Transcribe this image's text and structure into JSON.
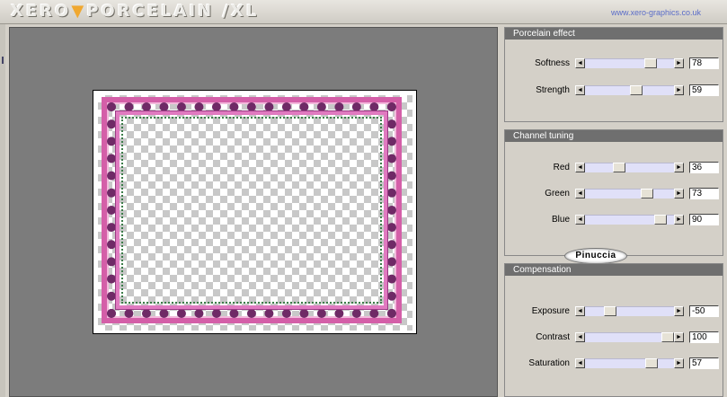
{
  "header": {
    "logo_text": "XERO",
    "logo_triangle": "▼",
    "logo_text2": "PORCELAIN /XL",
    "website": "www.xero-graphics.co.uk"
  },
  "colors": {
    "panel_title_bg": "#6f6f6f",
    "track": "#e0e0f8",
    "frame_pink": "#d45fa8",
    "preview_bg": "#7c7c7c"
  },
  "panels": [
    {
      "title": "Porcelain effect",
      "sliders": [
        {
          "label": "Softness",
          "value": "78",
          "fraction": 0.78
        },
        {
          "label": "Strength",
          "value": "59",
          "fraction": 0.59
        }
      ]
    },
    {
      "title": "Channel tuning",
      "sliders": [
        {
          "label": "Red",
          "value": "36",
          "fraction": 0.36
        },
        {
          "label": "Green",
          "value": "73",
          "fraction": 0.73
        },
        {
          "label": "Blue",
          "value": "90",
          "fraction": 0.9
        }
      ],
      "signature": "Pinuccia"
    },
    {
      "title": "Compensation",
      "sliders": [
        {
          "label": "Exposure",
          "value": "-50",
          "fraction": 0.25
        },
        {
          "label": "Contrast",
          "value": "100",
          "fraction": 1.0
        },
        {
          "label": "Saturation",
          "value": "57",
          "fraction": 0.785
        }
      ]
    }
  ],
  "icons": {
    "left_arrow": "◄",
    "right_arrow": "►"
  }
}
